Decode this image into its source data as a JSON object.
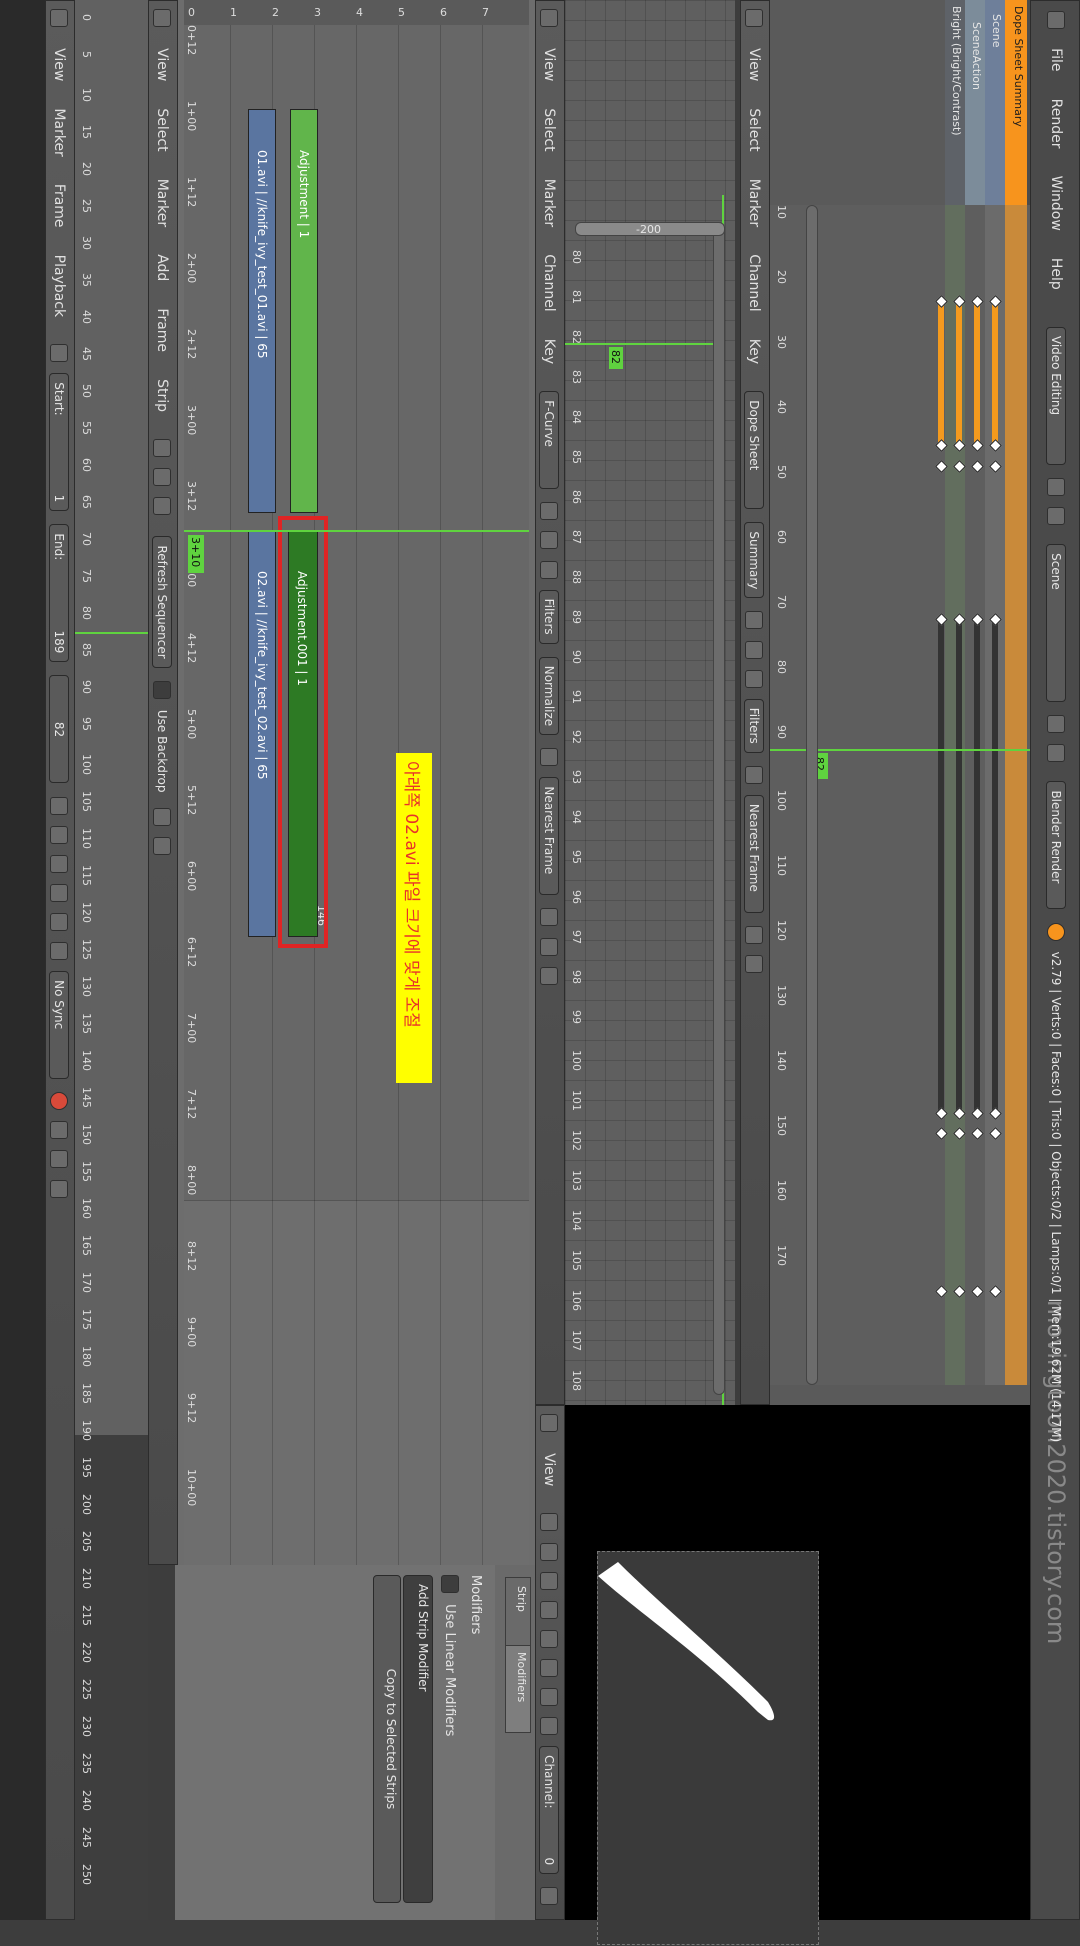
{
  "info_header": {
    "menus": [
      "File",
      "Render",
      "Window",
      "Help"
    ],
    "screen_layout": "Video Editing",
    "scene": "Scene",
    "render_engine": "Blender Render",
    "stats": "v2.79 | Verts:0 | Faces:0 | Tris:0 | Objects:0/2 | Lamps:0/1 | Mem:19.62M (14.17M)"
  },
  "dopesheet": {
    "channels": [
      "Dope Sheet Summary",
      "Scene",
      "SceneAction",
      "Bright (Bright/Contrast)"
    ],
    "menus": [
      "View",
      "Select",
      "Marker",
      "Channel",
      "Key"
    ],
    "mode": "Dope Sheet",
    "summary_btn": "Summary",
    "filters": "Filters",
    "snap": "Nearest Frame",
    "ticks": [
      "10",
      "20",
      "30",
      "40",
      "50",
      "60",
      "70",
      "80",
      "90",
      "100",
      "110",
      "120",
      "130",
      "140",
      "150",
      "160",
      "170"
    ],
    "current_frame": "82"
  },
  "graph_editor": {
    "menus": [
      "View",
      "Select",
      "Marker",
      "Channel",
      "Key"
    ],
    "mode": "F-Curve",
    "filters": "Filters",
    "normalize": "Normalize",
    "snap": "Nearest Frame",
    "scroll_value": "-200",
    "ticks": [
      "80",
      "81",
      "82",
      "83",
      "84",
      "85",
      "86",
      "87",
      "88",
      "89",
      "90",
      "91",
      "92",
      "93",
      "94",
      "95",
      "96",
      "97",
      "98",
      "99",
      "100",
      "101",
      "102",
      "103",
      "104",
      "105",
      "106",
      "107",
      "108"
    ],
    "current_frame": "82"
  },
  "sequencer": {
    "menus": [
      "View",
      "Select",
      "Marker",
      "Add",
      "Frame",
      "Strip"
    ],
    "refresh": "Refresh Sequencer",
    "use_backdrop": "Use Backdrop",
    "channel_numbers": [
      "0",
      "1",
      "2",
      "3",
      "4",
      "5",
      "6",
      "7"
    ],
    "ticks": [
      "0+12",
      "1+00",
      "1+12",
      "2+00",
      "2+12",
      "3+00",
      "3+12",
      "4+00",
      "4+12",
      "5+00",
      "5+12",
      "6+00",
      "6+12",
      "7+00",
      "7+12",
      "8+00",
      "8+12",
      "9+00",
      "9+12",
      "10+00"
    ],
    "current_time": "3+10",
    "strips": [
      {
        "label": "Adjustment | 1",
        "kind": "adjustment"
      },
      {
        "label": "01.avi | //knife_ivy_test_01.avi | 65",
        "kind": "movie"
      },
      {
        "label": "Adjustment.001 | 1",
        "kind": "adjustment-selected"
      },
      {
        "label": "02.avi | //knife_ivy_test_02.avi | 65",
        "kind": "movie"
      }
    ],
    "strip_end_label": "146",
    "annotation": "아래쪽 02.avi 파일 크기에 맞게 조절"
  },
  "preview": {
    "menus": [
      "View"
    ],
    "channel_label": "Channel:",
    "channel_value": "0"
  },
  "properties": {
    "tabs": [
      "Modifiers",
      "Strip"
    ],
    "panel": "Modifiers",
    "use_linear": "Use Linear Modifiers",
    "add_modifier": "Add Strip Modifier",
    "copy_selected": "Copy to Selected Strips"
  },
  "timeline": {
    "menus": [
      "View",
      "Marker",
      "Frame",
      "Playback"
    ],
    "start_label": "Start:",
    "start_value": "1",
    "end_label": "End:",
    "end_value": "189",
    "current_value": "82",
    "sync": "No Sync",
    "ticks": [
      "0",
      "5",
      "10",
      "15",
      "20",
      "25",
      "30",
      "35",
      "40",
      "45",
      "50",
      "55",
      "60",
      "65",
      "70",
      "75",
      "80",
      "85",
      "90",
      "95",
      "100",
      "105",
      "110",
      "115",
      "120",
      "125",
      "130",
      "135",
      "140",
      "145",
      "150",
      "155",
      "160",
      "165",
      "170",
      "175",
      "180",
      "185",
      "190",
      "195",
      "200",
      "205",
      "210",
      "215",
      "220",
      "225",
      "230",
      "235",
      "240",
      "245",
      "250"
    ]
  },
  "watermark": "movingtoon2020.tistory.com",
  "colors": {
    "accent_orange": "#f7941d",
    "playhead_green": "#5fd33f",
    "annotation_bg": "#ffff00",
    "annotation_text": "#e8312a",
    "highlight_red": "#e02424"
  }
}
